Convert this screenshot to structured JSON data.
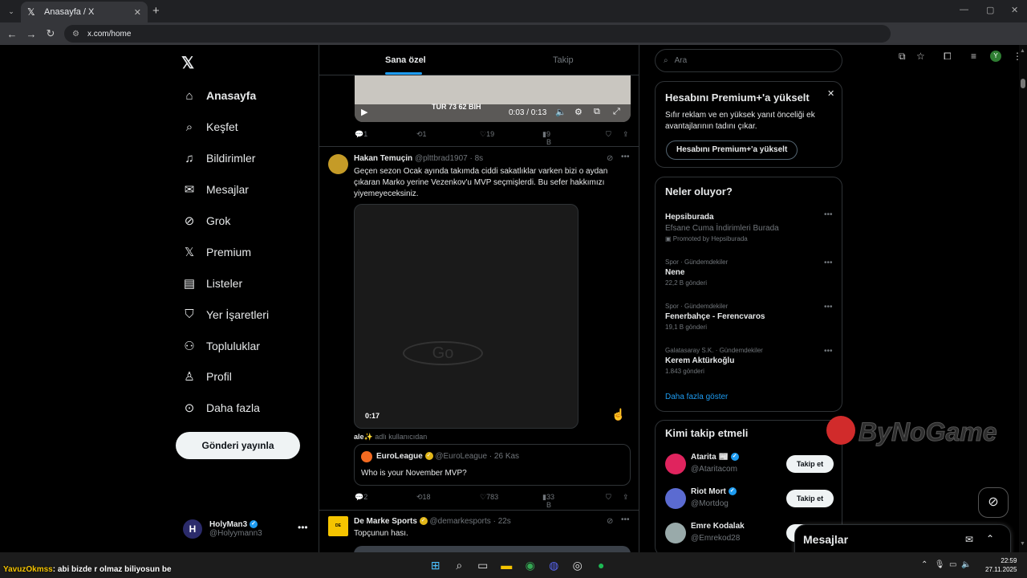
{
  "browser": {
    "tab_title": "Anasayfa / X",
    "tab_close": "✕",
    "new_tab": "+",
    "url": "x.com/home"
  },
  "left_nav": {
    "logo": "𝕏",
    "items": [
      {
        "label": "Anasayfa",
        "icon": "home-icon",
        "glyph": "⌂"
      },
      {
        "label": "Keşfet",
        "icon": "search-icon",
        "glyph": "⌕"
      },
      {
        "label": "Bildirimler",
        "icon": "bell-icon",
        "glyph": "♫"
      },
      {
        "label": "Mesajlar",
        "icon": "mail-icon",
        "glyph": "✉"
      },
      {
        "label": "Grok",
        "icon": "grok-icon",
        "glyph": "⊘"
      },
      {
        "label": "Premium",
        "icon": "x-premium-icon",
        "glyph": "𝕏"
      },
      {
        "label": "Listeler",
        "icon": "list-icon",
        "glyph": "▤"
      },
      {
        "label": "Yer İşaretleri",
        "icon": "bookmark-icon",
        "glyph": "⛉"
      },
      {
        "label": "Topluluklar",
        "icon": "communities-icon",
        "glyph": "⚇"
      },
      {
        "label": "Profil",
        "icon": "profile-icon",
        "glyph": "♙"
      },
      {
        "label": "Daha fazla",
        "icon": "more-circle-icon",
        "glyph": "⊙"
      }
    ],
    "post_button": "Gönderi yayınla",
    "account": {
      "name": "HolyMan3",
      "handle": "@Holyymann3",
      "initial": "H"
    }
  },
  "timeline": {
    "tabs": [
      "Sana özel",
      "Takip"
    ],
    "video1": {
      "time": "0:03 / 0:13",
      "score_label": "TUR  73  62  BIH"
    },
    "tweet0_actions": {
      "reply": "1",
      "retweet": "1",
      "like": "19",
      "views": "9 B"
    },
    "tweet1": {
      "name": "Hakan Temuçin",
      "handle": "@plttbrad1907",
      "time": "8s",
      "text": "Geçen sezon Ocak ayında takımda ciddi sakatlıklar varken bizi o aydan çıkaran Marko yerine Vezenkov'u MVP seçmişlerdi. Bu sefer hakkımızı yiyemeyeceksiniz.",
      "video_duration": "0:17",
      "quoted_from": "ale✨",
      "quoted_from_suffix": "adlı kullanıcıdan",
      "quote": {
        "name": "EuroLeague",
        "handle": "@EuroLeague",
        "time": "26 Kas",
        "text": "Who is your November MVP?"
      },
      "actions": {
        "reply": "2",
        "retweet": "18",
        "like": "783",
        "views": "33 B"
      }
    },
    "tweet2": {
      "name": "De Marke Sports",
      "handle": "@demarkesports",
      "time": "22s",
      "text": "Topçunun hası.",
      "avatar_text": "DE MARKE"
    }
  },
  "sidebar": {
    "search_placeholder": "Ara",
    "premium": {
      "title": "Hesabını Premium+'a yükselt",
      "desc": "Sıfır reklam ve en yüksek yanıt önceliği ek avantajlarının tadını çıkar.",
      "button": "Hesabını Premium+'a yükselt"
    },
    "trends_title": "Neler oluyor?",
    "trends": [
      {
        "name": "Hepsiburada",
        "sub": "Efsane Cuma İndirimleri Burada",
        "promo": "Promoted by Hepsiburada"
      },
      {
        "category": "Spor · Gündemdekiler",
        "name": "Nene",
        "count": "22,2 B gönderi"
      },
      {
        "category": "Spor · Gündemdekiler",
        "name": "Fenerbahçe - Ferencvaros",
        "count": "19,1 B gönderi"
      },
      {
        "category": "Galatasaray S.K. · Gündemdekiler",
        "name": "Kerem Aktürkoğlu",
        "count": "1.843 gönderi"
      }
    ],
    "show_more": "Daha fazla göster",
    "wtf_title": "Kimi takip etmeli",
    "people": [
      {
        "name": "Atarita 📰",
        "handle": "@Ataritacom",
        "button": "Takip et",
        "color": "#e0245e"
      },
      {
        "name": "Riot Mort",
        "handle": "@Mortdog",
        "button": "Takip et",
        "color": "#5b6bd1"
      },
      {
        "name": "Emre Kodalak",
        "handle": "@Emrekod28",
        "button": "Takip et",
        "color": "#9aa"
      }
    ],
    "messages_dock": "Mesajlar"
  },
  "watermark": "ByNoGame",
  "taskbar": {
    "chat_user": "YavuzOkmss",
    "chat_text": ": abi bizde r olmaz biliyosun be",
    "time": "22:59",
    "date": "27.11.2025"
  },
  "colors": {
    "accent": "#1d9bf0",
    "bg": "#000000",
    "border": "#2f3336",
    "muted": "#71767b"
  }
}
